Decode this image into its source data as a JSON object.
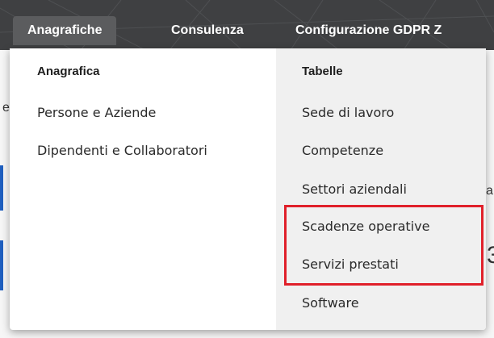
{
  "topnav": {
    "items": [
      {
        "label": "Anagrafiche"
      },
      {
        "label": "Consulenza"
      },
      {
        "label": "Configurazione GDPR Z"
      }
    ]
  },
  "menu": {
    "left_column": {
      "header": "Anagrafica",
      "items": [
        "Persone e Aziende",
        "Dipendenti e Collaboratori"
      ]
    },
    "right_column": {
      "header": "Tabelle",
      "items": [
        "Sede di lavoro",
        "Competenze",
        "Settori aziendali",
        "Scadenze operative",
        "Servizi prestati",
        "Software"
      ]
    }
  },
  "background_fragments": {
    "peek_a": "a",
    "peek_3": "3",
    "peek_e": "e"
  },
  "colors": {
    "topbar": "#3f4042",
    "active_tab": "#5b5c5e",
    "highlight": "#e0202a",
    "accent_blue": "#1f5fbf"
  }
}
